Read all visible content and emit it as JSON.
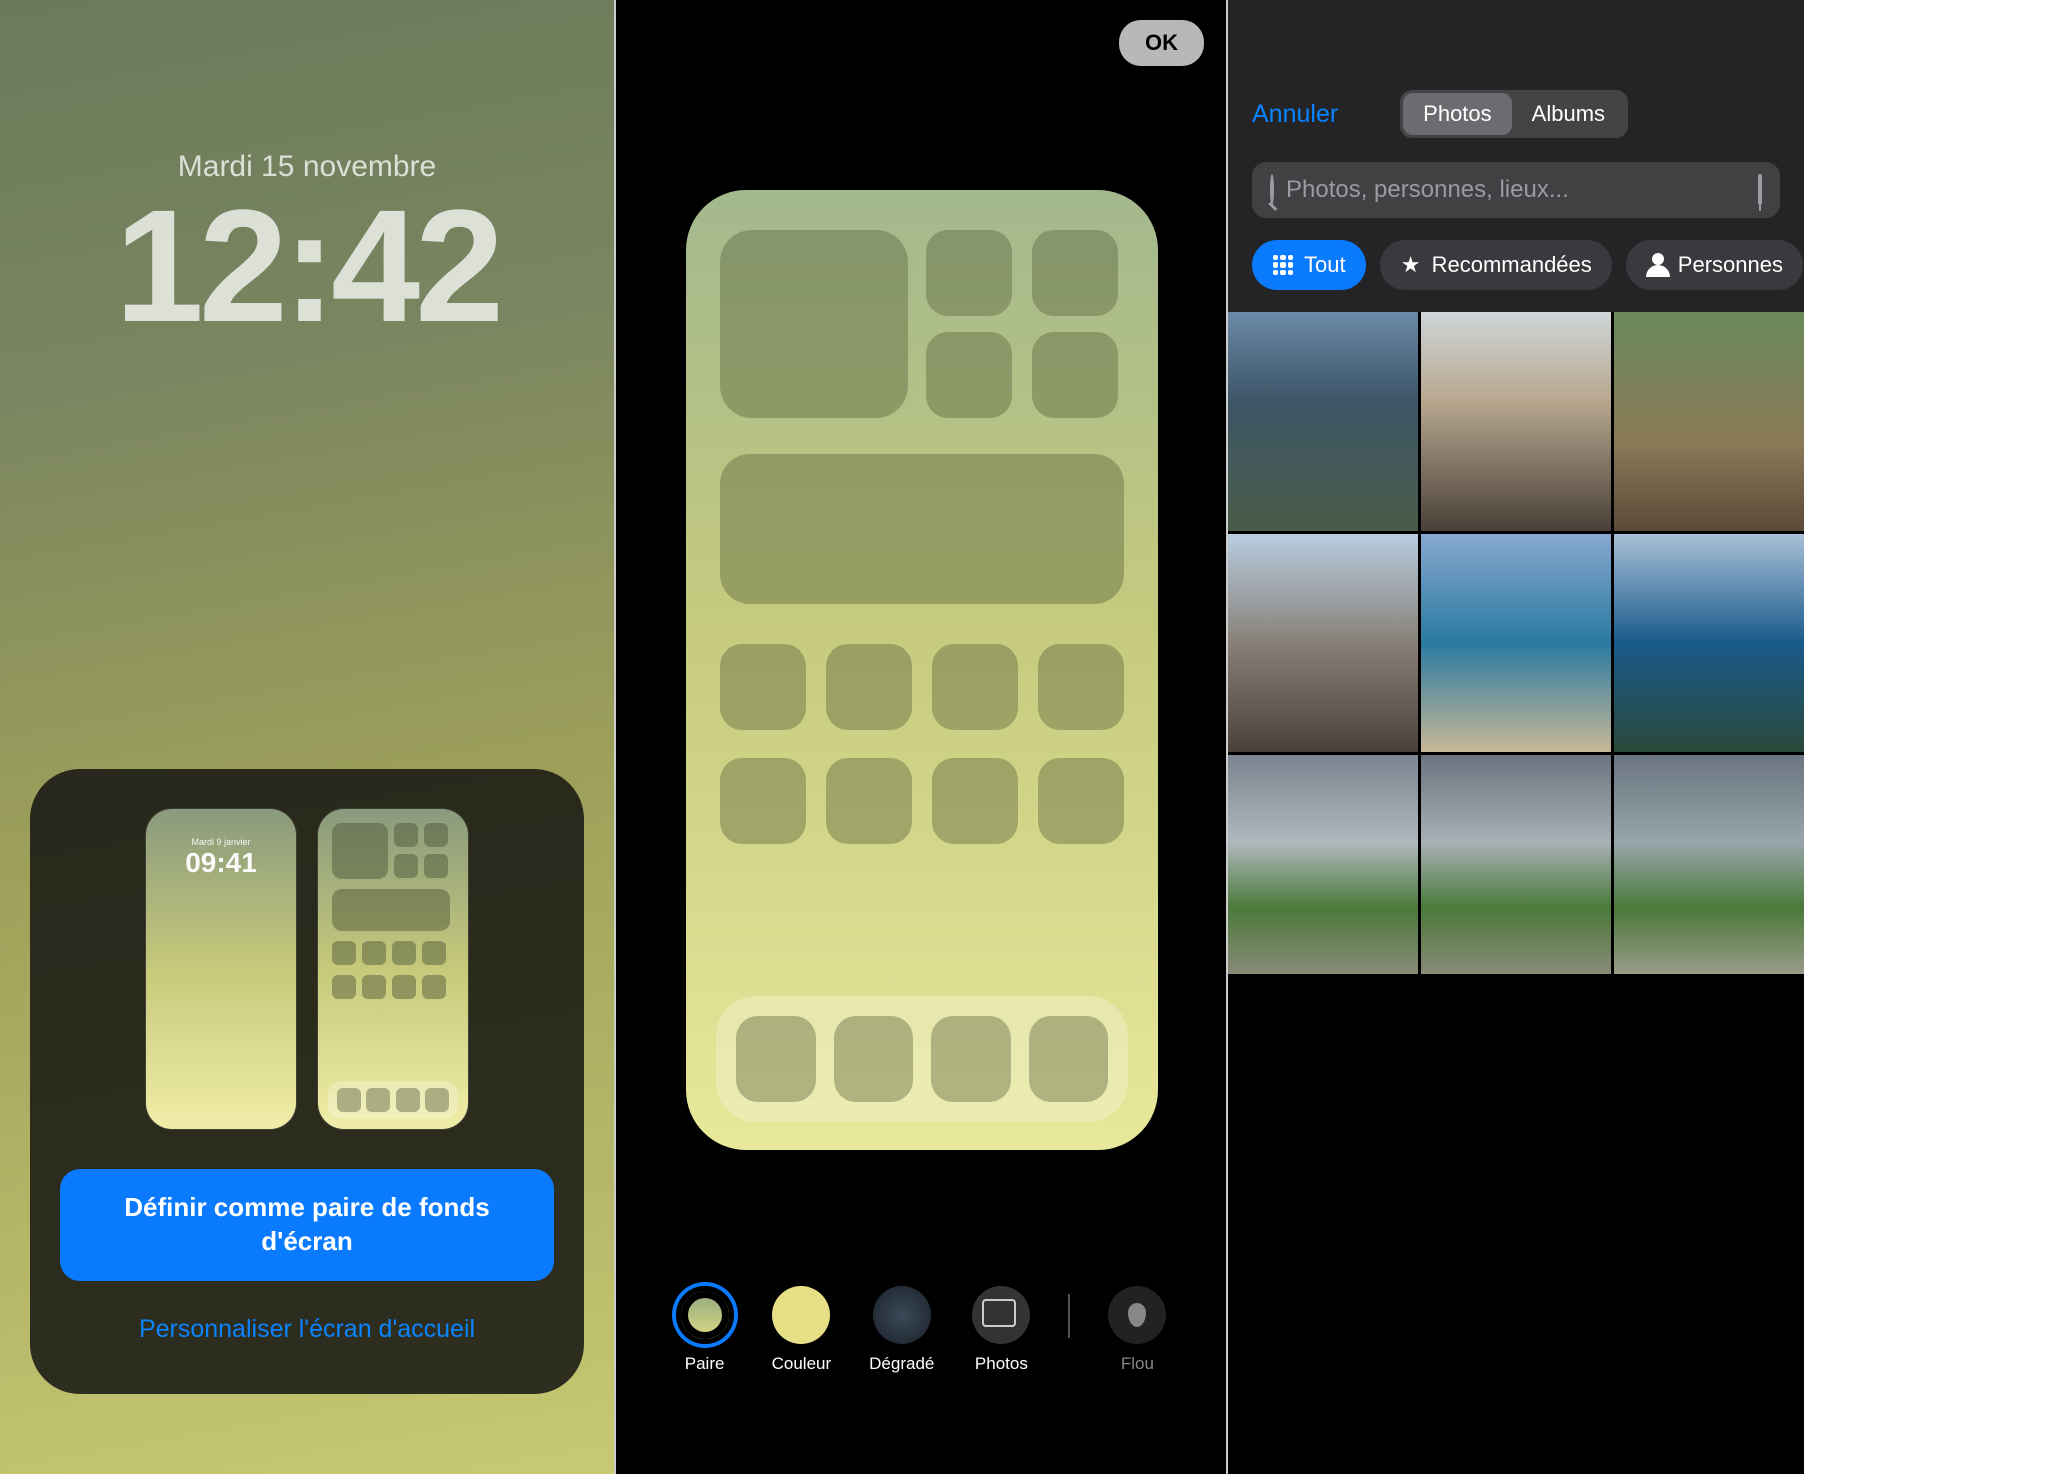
{
  "panel1": {
    "date": "Mardi 15 novembre",
    "time": "12:42",
    "mini_date": "Mardi 9 janvier",
    "mini_time": "09:41",
    "set_pair_button": "Définir comme paire de fonds d'écran",
    "customize_link": "Personnaliser l'écran d'accueil"
  },
  "panel2": {
    "ok": "OK",
    "tools": {
      "paire": "Paire",
      "couleur": "Couleur",
      "degrade": "Dégradé",
      "photos": "Photos",
      "flou": "Flou"
    }
  },
  "panel3": {
    "cancel": "Annuler",
    "tabs": {
      "photos": "Photos",
      "albums": "Albums"
    },
    "search_placeholder": "Photos, personnes, lieux...",
    "filters": {
      "all": "Tout",
      "recommended": "Recommandées",
      "people": "Personnes"
    }
  },
  "colors": {
    "accent": "#0a7aff"
  }
}
